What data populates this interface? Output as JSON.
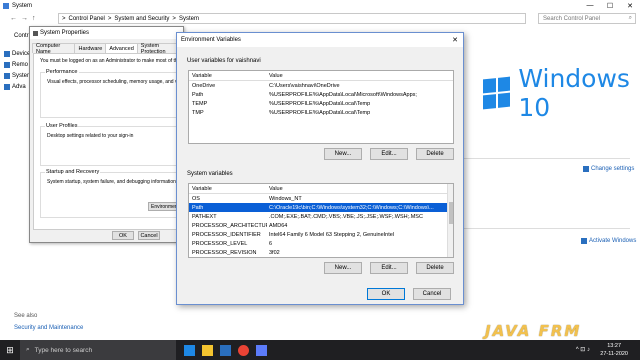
{
  "system_window": {
    "title": "System",
    "controls": {
      "minimize": "—",
      "maximize": "☐",
      "close": "✕"
    },
    "nav": {
      "back": "←",
      "forward": "→",
      "up": "↑"
    },
    "breadcrumb": [
      "Control Panel",
      "System and Security",
      "System"
    ],
    "breadcrumb_sep": ">",
    "search_placeholder": "Search Control Panel",
    "left_pane_label": "Contr",
    "left_links": [
      "Device",
      "Remo",
      "System",
      "Adva"
    ],
    "windows_logo_text": "Windows 10",
    "change_settings": "Change settings",
    "activate_windows": "Activate Windows",
    "see_also": "See also",
    "security_maintenance": "Security and Maintenance",
    "behind_text": "Windows"
  },
  "system_properties": {
    "title": "System Properties",
    "tabs": [
      "Computer Name",
      "Hardware",
      "Advanced",
      "System Protection"
    ],
    "active_tab": "Advanced",
    "note": "You must be logged on as an Administrator to make most of th",
    "groups": [
      {
        "label": "Performance",
        "desc": "Visual effects, processor scheduling, memory usage, and virtu"
      },
      {
        "label": "User Profiles",
        "desc": "Desktop settings related to your sign-in"
      },
      {
        "label": "Startup and Recovery",
        "desc": "System startup, system failure, and debugging information"
      }
    ],
    "env_button": "Environmen",
    "ok": "OK",
    "cancel": "Cancel"
  },
  "env_dialog": {
    "title": "Environment Variables",
    "close": "✕",
    "user_section": "User variables for vaishnavi",
    "system_section": "System variables",
    "col_variable": "Variable",
    "col_value": "Value",
    "user_vars": [
      {
        "variable": "OneDrive",
        "value": "C:\\Users\\vaishnavi\\OneDrive"
      },
      {
        "variable": "Path",
        "value": "%USERPROFILE%\\AppData\\Local\\Microsoft\\WindowsApps;"
      },
      {
        "variable": "TEMP",
        "value": "%USERPROFILE%\\AppData\\Local\\Temp"
      },
      {
        "variable": "TMP",
        "value": "%USERPROFILE%\\AppData\\Local\\Temp"
      }
    ],
    "system_vars": [
      {
        "variable": "OS",
        "value": "Windows_NT"
      },
      {
        "variable": "Path",
        "value": "C:\\Oracle19c\\bin;C:\\Windows\\system32;C:\\Windows;C:\\Windows\\..."
      },
      {
        "variable": "PATHEXT",
        "value": ".COM;.EXE;.BAT;.CMD;.VBS;.VBE;.JS;.JSE;.WSF;.WSH;.MSC"
      },
      {
        "variable": "PROCESSOR_ARCHITECTURE",
        "value": "AMD64"
      },
      {
        "variable": "PROCESSOR_IDENTIFIER",
        "value": "Intel64 Family 6 Model 63 Stepping 2, GenuineIntel"
      },
      {
        "variable": "PROCESSOR_LEVEL",
        "value": "6"
      },
      {
        "variable": "PROCESSOR_REVISION",
        "value": "3f02"
      }
    ],
    "selected_system_index": 1,
    "new": "New...",
    "edit": "Edit...",
    "delete": "Delete",
    "ok": "OK",
    "cancel": "Cancel"
  },
  "watermark": "JAVA FRM",
  "taskbar": {
    "search_placeholder": "Type here to search",
    "time": "13:27",
    "date": "27-11-2020",
    "tray": "^ ⊡ ♪"
  }
}
